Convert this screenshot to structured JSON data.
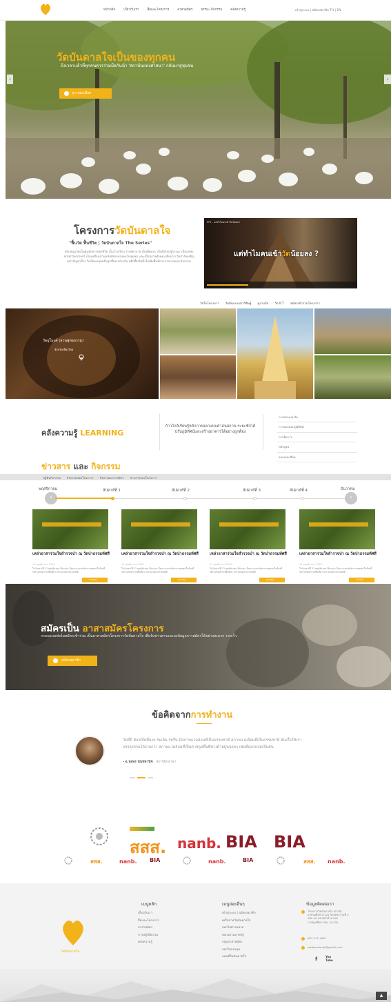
{
  "header": {
    "logo_icon": "bodhi-leaf-icon",
    "nav": [
      "หน้าหลัก",
      "เกี่ยวกับเรา",
      "สื่อและโครงการ",
      "อาสาสมัคร",
      "ธรรมะ กิจกรรม",
      "คลังความรู้"
    ],
    "top_right": "เข้าสู่ระบบ | สมัครสมาชิก  TH | EN"
  },
  "hero": {
    "title": "วัดบันดาลใจเป็นของทุกคน",
    "subtitle": "ถึงเวลาแล้วที่ทุกคนควรร่วมมือกันนำ 'สถาบันแห่งศาสนา' กลับมาสู่ชุมชน",
    "button": "ดูรายละเอียด",
    "prev_icon": "chevron-left-icon",
    "next_icon": "chevron-right-icon"
  },
  "project": {
    "title_prefix": "โครงการ",
    "title_highlight": "วัดบันดาลใจ",
    "quote": "\"ฟื้นวัด ฟื้นชีวิต | วัดบันดาลใจ The Series\"",
    "description": "สนับสนุนวัดเป็นศูนย์กลางของชีวิต เป็นโรงเรียน โรงพยาบาล เป็นที่พบปะ เป็นที่เรียนรู้ธรรมะ เป็นแหล่ง entertainment เป็นเหมือนบ้านหลังที่สองของคนในชุมชน และเมื่อสภาพสังคมเปลี่ยนไป วัดกำลังเผชิญหน้าปัญหาทั้งฯ วันนี้คนกลุ่มหนึ่งลุกขึ้นมาช่วยกัน พลิกฟื้นวัดทั้งในเชิงพื้นที่ทางกายภาพและกิจกรรม",
    "video_title": "แต่ทำไมคนเข้าวัดน้อยลง ?",
    "video_highlight": "วัด",
    "video_header": "EP1 - แต่ทำไมคนเข้าวัดน้อยลง"
  },
  "subnav": [
    "วัดในโครงการ",
    "วัดต้นแบบปรารีดิษฐ์",
    "ดูงานวัด",
    "วัด ICT",
    "สมัครเข้าร่วมโครงการ"
  ],
  "gallery": {
    "main_title": "วัดอุโมงค์ (สวนพุทธธรรม)",
    "main_location": "จังหวัดเชียงใหม่",
    "pin_icon": "map-pin-icon"
  },
  "learning": {
    "title_prefix": "คลังความรู้",
    "title_highlight": "LEARNING",
    "middle_text": "ก้าวใกล้เรียนรู้หลักการออกแบบศาสนสถาน ระยะชักได้ปรับภูมิทัศน์และสร้างอาคารได้อย่างถูกต้อง",
    "list": [
      "การออกแบบวัด",
      "การออกแบบภูมิทัศน์",
      "การจัดการ",
      "หลักสูตร",
      "ออกแบบเรียน"
    ]
  },
  "news": {
    "title_highlight1": "ข่าวสาร",
    "title_and": "และ",
    "title_highlight2": "กิจกรรม",
    "tabs": [
      "ปฏิทินกิจกรรม",
      "กิจกรรมของโครงการ",
      "กิจกรรมอาสาสมัคร",
      "ข่าวสารของโครงการ"
    ],
    "months": [
      "พฤศจิกายน",
      "ธันวาคม"
    ],
    "weeks": [
      "สัปดาห์ที่ 1",
      "สัปดาห์ที่ 2",
      "สัปดาห์ที่ 3",
      "สัปดาห์ที่ 4"
    ],
    "cards": [
      {
        "title": "เหล่าอาสาร่วมใจสำรวจป่า ณ วัดป่าธรรมทัศสี",
        "date": "14 พฤศจิกายน 2560",
        "desc": "ในวันเสาร์ที่ 11 พฤศจิกายน ที่ผ่านมา มีคณะอาสาสมัครจากชุมชนในท้องที่ได้ร่วมกันสำรวจพื้นที่ป่า บริเวณวัดป่าธรรมทัศสี",
        "btn": "อ่านต่อ"
      },
      {
        "title": "เหล่าอาสาร่วมใจสำรวจป่า ณ วัดป่าธรรมทัศสี",
        "date": "14 พฤศจิกายน 2560",
        "desc": "ในวันเสาร์ที่ 11 พฤศจิกายน ที่ผ่านมา มีคณะอาสาสมัครจากชุมชนในท้องที่ได้ร่วมกันสำรวจพื้นที่ป่า บริเวณวัดป่าธรรมทัศสี",
        "btn": "อ่านต่อ"
      },
      {
        "title": "เหล่าอาสาร่วมใจสำรวจป่า ณ วัดป่าธรรมทัศสี",
        "date": "14 พฤศจิกายน 2560",
        "desc": "ในวันเสาร์ที่ 11 พฤศจิกายน ที่ผ่านมา มีคณะอาสาสมัครจากชุมชนในท้องที่ได้ร่วมกันสำรวจพื้นที่ป่า บริเวณวัดป่าธรรมทัศสี",
        "btn": "อ่านต่อ"
      },
      {
        "title": "เหล่าอาสาร่วมใจสำรวจป่า ณ วัดป่าธรรมทัศสี",
        "date": "14 พฤศจิกายน 2560",
        "desc": "ในวันเสาร์ที่ 11 พฤศจิกายน ที่ผ่านมา มีคณะอาสาสมัครจากชุมชนในท้องที่ได้ร่วมกันสำรวจพื้นที่ป่า บริเวณวัดป่าธรรมทัศสี",
        "btn": "อ่านต่อ"
      }
    ]
  },
  "volunteer": {
    "title_prefix": "สมัครเป็น",
    "title_highlight": "อาสาสมัครโครงการ",
    "desc": "กรอกแบบฟอร์มสมัครเข้าร่วม เป็นอาสาสมัครโครงการวัดบันดาลใจ เพื่อรับข่าวสารและลงข้อมูลการสมัครได้อย่างสะดวก รวดเร็ว",
    "button": "สมัครสมาชิก"
  },
  "opinion": {
    "title_prefix": "ข้อคิดจาก",
    "title_highlight": "การทำงาน",
    "quote": "วัดที่ดี ต้องเป็นที่สงบ ร่มเย็น ร่มรื่น มีสภาพแวดล้อมที่เป็นธรรมชาติ สภาพแวดล้อมที่เป็นธรรมชาติ มันเกื้อให้เราบรรลุธรรมได้ง่ายกว่า สภาพแวดล้อมที่เป็นคาสตูปพื้นที่ทางด้วยปูนบ่อยๆ เช่นที่ออกแบบเป็นต้น",
    "author": "- อ.จุลพร นันทพานิช",
    "author_role": ", สถาปนิกอาสา"
  },
  "partners": {
    "big": [
      "emblem",
      "สสส.",
      "nanb.",
      "BIA",
      "BIA"
    ],
    "small": [
      "emblem",
      "สสส.",
      "nanb.",
      "BIA",
      "emblem",
      "nanb.",
      "BIA",
      "emblem",
      "สสส.",
      "nanb."
    ]
  },
  "footer": {
    "logo_text": "วัดบันดาลใจ",
    "col1_head": "เมนูหลัก",
    "col1": [
      "เกี่ยวกับเรา",
      "สื่อและโครงการ",
      "อาสาสมัคร",
      "การปฏิบัติธรรม",
      "คลังความรู้"
    ],
    "col2_head": "เมนูย่อยอื่นๆ",
    "col2": [
      "เข้าสู่ระบบ | สมัครสมาชิก",
      "เครือข่ายวัดบันดาลใจ",
      "ออกไปต่างหน่วย",
      "หน่วยงานภาครัฐ",
      "กลุ่มอาสาสมัคร",
      "ออกไปกองทุน",
      "แผนที่วัดบันดาลใจ"
    ],
    "col3_head": "ข้อมูลติดต่อเรา",
    "address": "โครงการวัดบันดาลใจ สถาบันอาศรมศิลป์ 5/125 ซอยพระรามที่ 2 ซอย 40 แขวงท่าข้าม เขตบางขุนเทียน กทม. 10150",
    "phone": "081 372 4567",
    "email": "watbandanjai@gmail.com",
    "social": [
      "f",
      "You Tube"
    ],
    "top_button": "▲"
  },
  "colors": {
    "accent": "#f2b21a",
    "text": "#444444"
  }
}
